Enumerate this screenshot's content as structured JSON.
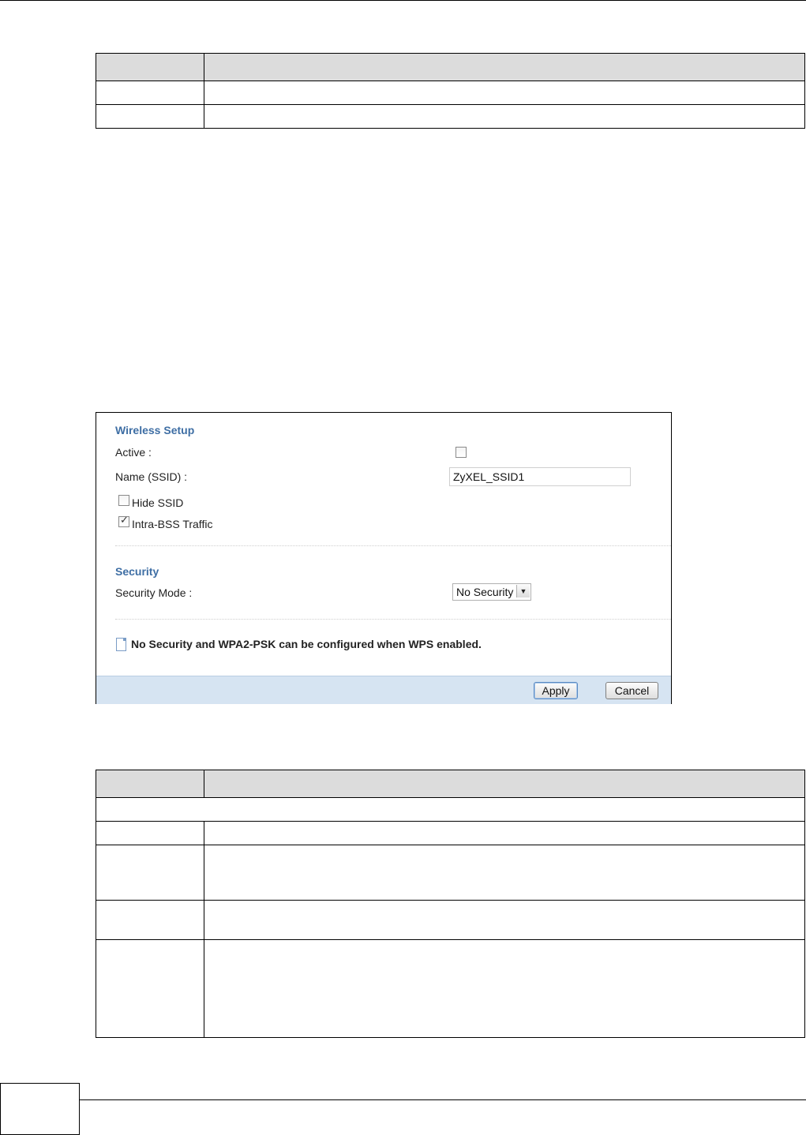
{
  "panel": {
    "wireless_setup_title": "Wireless Setup",
    "active_label": "Active :",
    "active_checked": false,
    "name_label": "Name (SSID) :",
    "ssid_value": "ZyXEL_SSID1",
    "hide_ssid_label": "Hide SSID",
    "hide_ssid_checked": false,
    "intra_bss_label": "Intra-BSS Traffic",
    "intra_bss_checked": true,
    "security_title": "Security",
    "security_mode_label": "Security Mode :",
    "security_mode_value": "No Security",
    "note": "No Security and WPA2-PSK can be configured when WPS enabled.",
    "apply_label": "Apply",
    "cancel_label": "Cancel"
  },
  "colors": {
    "section_title": "#3e6ea4",
    "footer_bar": "#d6e4f2",
    "table_header": "#dcdcdc"
  }
}
